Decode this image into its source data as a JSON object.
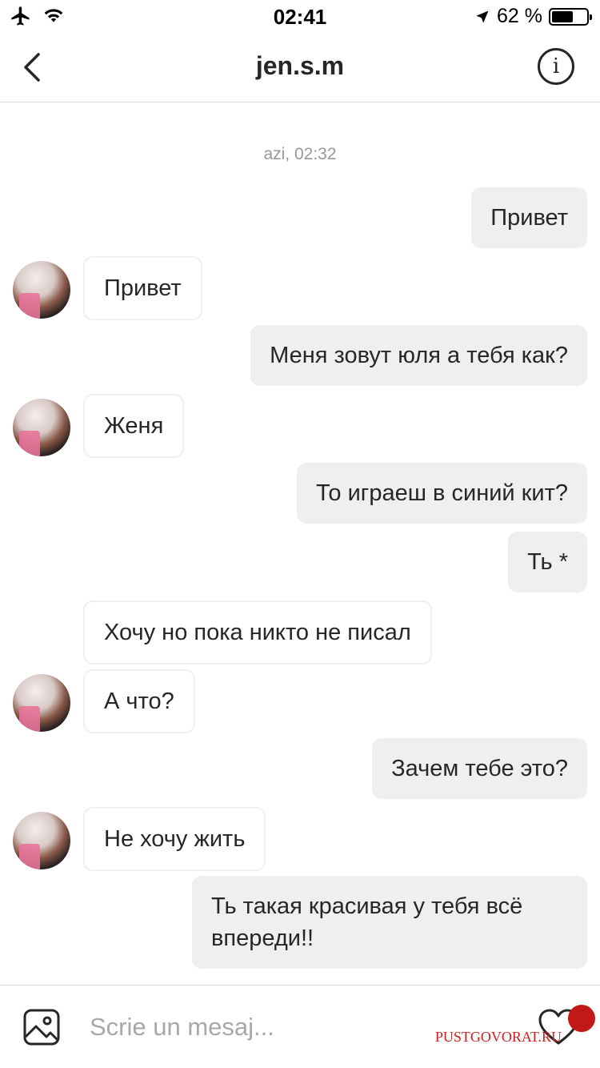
{
  "status_bar": {
    "time": "02:41",
    "battery_text": "62 %",
    "battery_level": 0.62
  },
  "header": {
    "title": "jen.s.m",
    "back_icon": "chevron-left-icon",
    "info_icon": "info-icon",
    "info_glyph": "i"
  },
  "thread": {
    "timestamp": "azi, 02:32",
    "messages": [
      {
        "from": "me",
        "text": "Привет"
      },
      {
        "from": "them",
        "text": "Привет"
      },
      {
        "from": "me",
        "text": "Меня зовут юля а тебя как?"
      },
      {
        "from": "them",
        "text": "Женя"
      },
      {
        "from": "me",
        "text": "То играеш в синий кит?"
      },
      {
        "from": "me",
        "text": "Ть *"
      },
      {
        "from": "them",
        "text": "Хочу но пока никто не писал"
      },
      {
        "from": "them",
        "text": "А что?"
      },
      {
        "from": "me",
        "text": "Зачем тебе это?"
      },
      {
        "from": "them",
        "text": "Не хочу жить"
      },
      {
        "from": "me",
        "text": "Ть такая красивая у тебя всё впереди!!"
      }
    ]
  },
  "composer": {
    "placeholder": "Scrie un mesaj...",
    "gallery_icon": "image-gallery-icon",
    "heart_icon": "heart-icon"
  },
  "watermark": {
    "text": "PUSTGOVORAT.RU"
  },
  "colors": {
    "sent_bubble": "#efefef",
    "received_border": "#efefef",
    "divider": "#dbdbdb",
    "timestamp": "#999999",
    "watermark": "#d21f1f"
  }
}
